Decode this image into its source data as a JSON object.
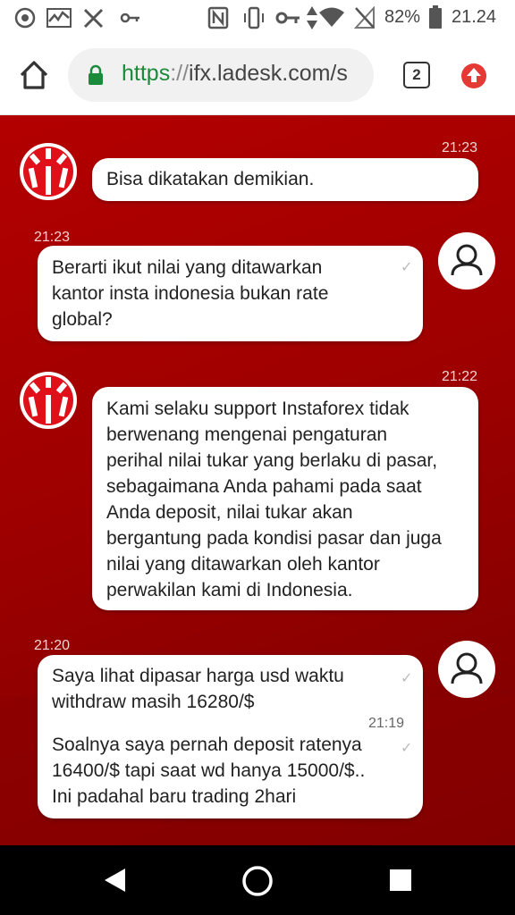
{
  "status_bar": {
    "battery": "82%",
    "clock": "21.24"
  },
  "browser": {
    "url_scheme": "https",
    "url_rest": "ifx.ladesk.com/s",
    "tab_count": "2"
  },
  "messages": [
    {
      "from": "agent",
      "time": "21:23",
      "text": "Bisa dikatakan demikian."
    },
    {
      "from": "user",
      "time": "21:23",
      "text": "Berarti ikut nilai yang ditawarkan\nkantor insta indonesia bukan rate\nglobal?"
    },
    {
      "from": "agent",
      "time": "21:22",
      "text": "Kami selaku support Instaforex tidak\nberwenang mengenai pengaturan\nperihal nilai tukar yang berlaku di pasar,\nsebagaimana Anda pahami pada saat\nAnda deposit, nilai tukar akan\nbergantung pada kondisi pasar dan juga\nnilai yang ditawarkan oleh kantor\nperwakilan kami di Indonesia."
    },
    {
      "from": "user",
      "time": "21:20",
      "text": "Saya lihat dipasar harga usd waktu\nwithdraw masih 16280/$",
      "time2": "21:19",
      "text2": "Soalnya saya pernah deposit ratenya\n16400/$ tapi saat wd hanya 15000/$..\nIni padahal baru trading 2hari"
    }
  ],
  "colors": {
    "chat_bg": "#a30000",
    "url_scheme": "#1b8a3a",
    "update_icon": "#e53935"
  }
}
